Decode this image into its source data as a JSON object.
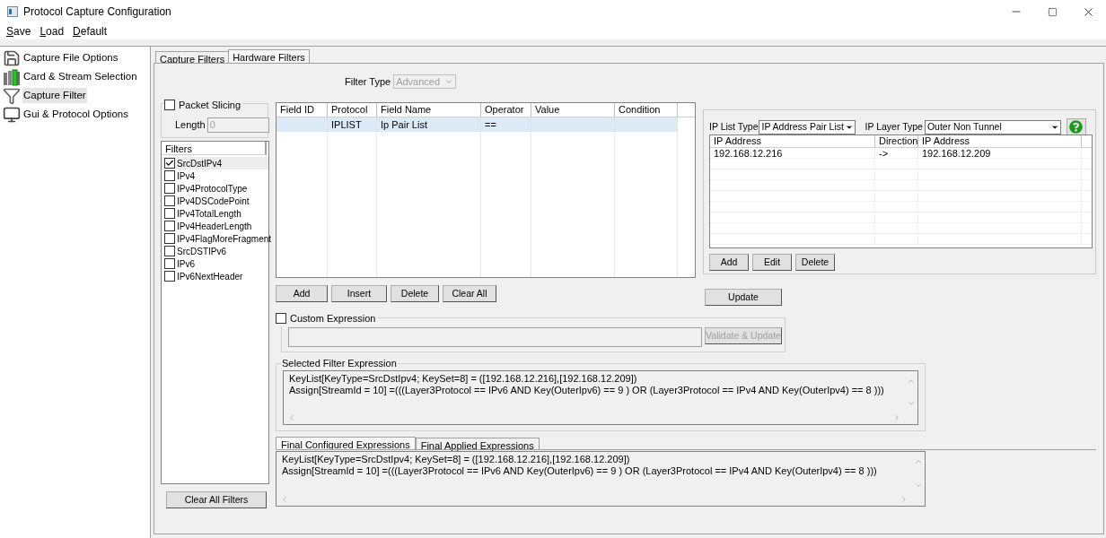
{
  "window": {
    "title": "Protocol Capture Configuration"
  },
  "menu": [
    "Save",
    "Load",
    "Default"
  ],
  "sidebar": {
    "items": [
      {
        "label": "Capture File Options",
        "selected": false
      },
      {
        "label": "Card & Stream Selection",
        "selected": false
      },
      {
        "label": "Capture Filter",
        "selected": true
      },
      {
        "label": "Gui & Protocol Options",
        "selected": false
      }
    ]
  },
  "tabs": [
    {
      "label": "Capture Filters",
      "selected": false
    },
    {
      "label": "Hardware Filters",
      "selected": true
    }
  ],
  "filter_type": {
    "label": "Filter Type",
    "value": "Advanced",
    "disabled": true
  },
  "packet_slicing": {
    "label": "Packet Slicing",
    "checked": false,
    "length_label": "Length",
    "length_value": "0"
  },
  "filters": {
    "header": "Filters",
    "items": [
      {
        "label": "SrcDstIPv4",
        "checked": true,
        "selected": true
      },
      {
        "label": "IPv4",
        "checked": false,
        "selected": false
      },
      {
        "label": "IPv4ProtocolType",
        "checked": false,
        "selected": false
      },
      {
        "label": "IPv4DSCodePoint",
        "checked": false,
        "selected": false
      },
      {
        "label": "IPv4TotalLength",
        "checked": false,
        "selected": false
      },
      {
        "label": "IPv4HeaderLength",
        "checked": false,
        "selected": false
      },
      {
        "label": "IPv4FlagMoreFragment",
        "checked": false,
        "selected": false
      },
      {
        "label": "SrcDSTIPv6",
        "checked": false,
        "selected": false
      },
      {
        "label": "IPv6",
        "checked": false,
        "selected": false
      },
      {
        "label": "IPv6NextHeader",
        "checked": false,
        "selected": false
      }
    ]
  },
  "clear_all_filters": "Clear All Filters",
  "field_table": {
    "columns": [
      "Field ID",
      "Protocol",
      "Field Name",
      "Operator",
      "Value",
      "Condition"
    ],
    "rows": [
      {
        "protocol": "IPLIST",
        "field_name": "Ip Pair List",
        "operator": "==",
        "selected": true
      }
    ]
  },
  "table_buttons": [
    "Add",
    "Insert",
    "Delete",
    "Clear All"
  ],
  "ip_panel": {
    "list_type_label": "IP List Type",
    "list_type": "IP Address Pair List",
    "layer_type_label": "IP Layer Type",
    "layer_type": "Outer Non Tunnel",
    "columns": [
      "IP Address",
      "Direction",
      "IP Address"
    ],
    "rows": [
      [
        "192.168.12.216",
        "->",
        "192.168.12.209"
      ]
    ],
    "buttons": [
      "Add",
      "Edit",
      "Delete"
    ]
  },
  "update_button": "Update",
  "custom_expression": {
    "label": "Custom Expression",
    "checked": false,
    "button": "Validate & Update",
    "button_disabled": true
  },
  "selected_filter_expression": {
    "title": "Selected Filter Expression",
    "lines": [
      "KeyList[KeyType=SrcDstIpv4; KeySet=8] = ([192.168.12.216],[192.168.12.209])",
      "Assign[StreamId = 10] =(((Layer3Protocol == IPv6 AND Key(OuterIpv6) == 9 ) OR (Layer3Protocol == IPv4 AND Key(OuterIpv4) == 8 )))"
    ]
  },
  "expression_tabs": [
    {
      "label": "Final Configured Expressions",
      "selected": true
    },
    {
      "label": "Final Applied Expressions",
      "selected": false
    }
  ],
  "final_expression": {
    "lines": [
      "KeyList[KeyType=SrcDstIpv4; KeySet=8] = ([192.168.12.216],[192.168.12.209])",
      "Assign[StreamId = 10] =(((Layer3Protocol == IPv6 AND Key(OuterIpv6) == 9 ) OR (Layer3Protocol == IPv4 AND Key(OuterIpv4) == 8 )))"
    ]
  }
}
